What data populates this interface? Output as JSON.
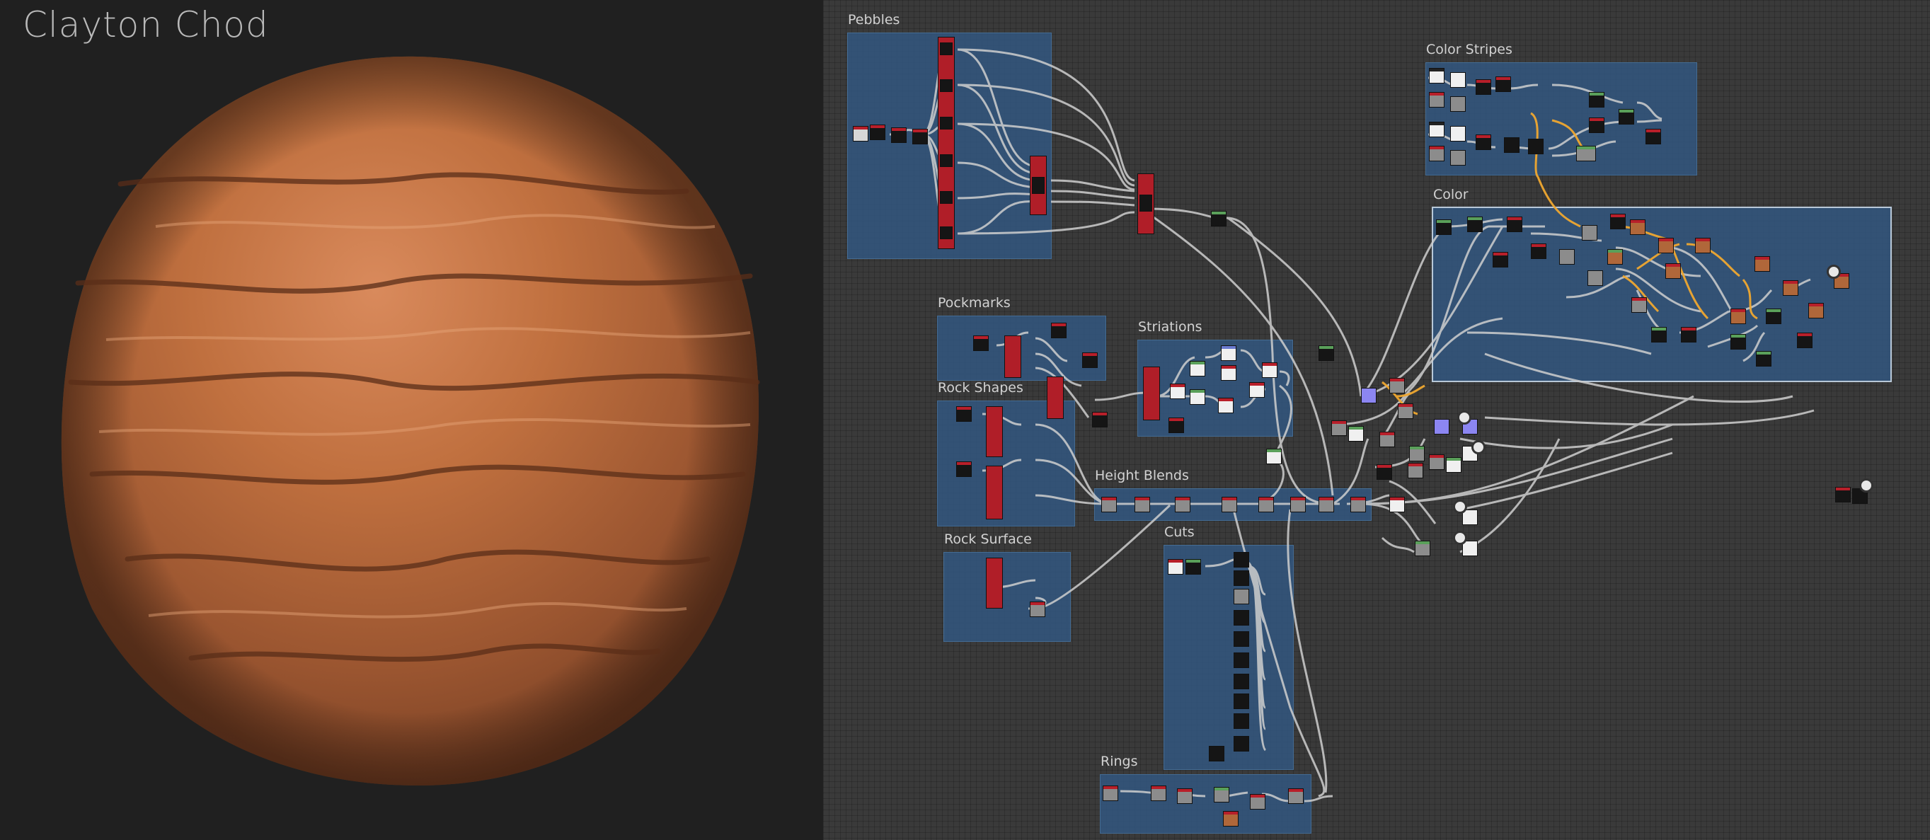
{
  "author": "Clayton Chod",
  "frames": {
    "pebbles": "Pebbles",
    "color_stripes": "Color Stripes",
    "color": "Color",
    "pockmarks": "Pockmarks",
    "striations": "Striations",
    "rock_shapes": "Rock Shapes",
    "height_blends": "Height Blends",
    "rock_surface": "Rock Surface",
    "cuts": "Cuts",
    "rings": "Rings"
  },
  "colors": {
    "frame_fill": "#325882",
    "wire": "#cfcfcf",
    "wire_highlight": "#f0a830",
    "node_header": "#b81f2a",
    "material_base": "#b0673a"
  }
}
